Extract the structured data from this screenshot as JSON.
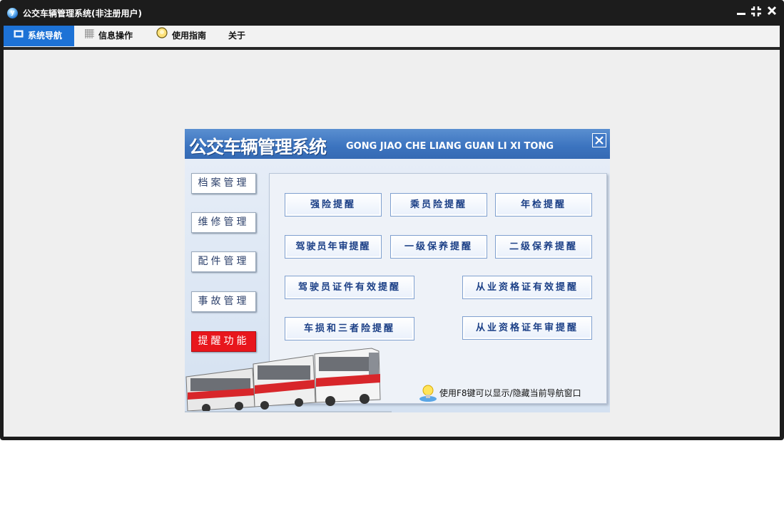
{
  "window": {
    "title": "公交车辆管理系统(非注册用户)",
    "icon": "app-logo-icon",
    "controls": {
      "minimize": "▁",
      "restore": "⤓",
      "close": "✕"
    }
  },
  "menu": {
    "tabs": [
      {
        "label": "系统导航",
        "icon": "monitor-icon",
        "active": true
      },
      {
        "label": "信息操作",
        "icon": "grid-icon",
        "active": false
      },
      {
        "label": "使用指南",
        "icon": "bulb-icon",
        "active": false
      },
      {
        "label": "关于",
        "icon": "",
        "active": false
      }
    ]
  },
  "nav_panel": {
    "title": "公交车辆管理系统",
    "subtitle": "GONG JIAO CHE LIANG GUAN LI XI TONG",
    "close_label": "✕",
    "sidebar": [
      {
        "label": "档案管理",
        "highlight": false
      },
      {
        "label": "维修管理",
        "highlight": false
      },
      {
        "label": "配件管理",
        "highlight": false
      },
      {
        "label": "事故管理",
        "highlight": false
      },
      {
        "label": "提醒功能",
        "highlight": true
      }
    ],
    "reminders": [
      "强险提醒",
      "乘员险提醒",
      "年检提醒",
      "驾驶员年审提醒",
      "一级保养提醒",
      "二级保养提醒",
      "驾驶员证件有效提醒",
      "从业资格证有效提醒",
      "车损和三者险提醒",
      "从业资格证年审提醒"
    ],
    "tip": "使用F8键可以显示/隐藏当前导航窗口"
  },
  "colors": {
    "accent": "#1d72d6",
    "panel_header": "#3b73bf",
    "alert_button": "#e8161c",
    "button_text": "#1b3f86"
  }
}
